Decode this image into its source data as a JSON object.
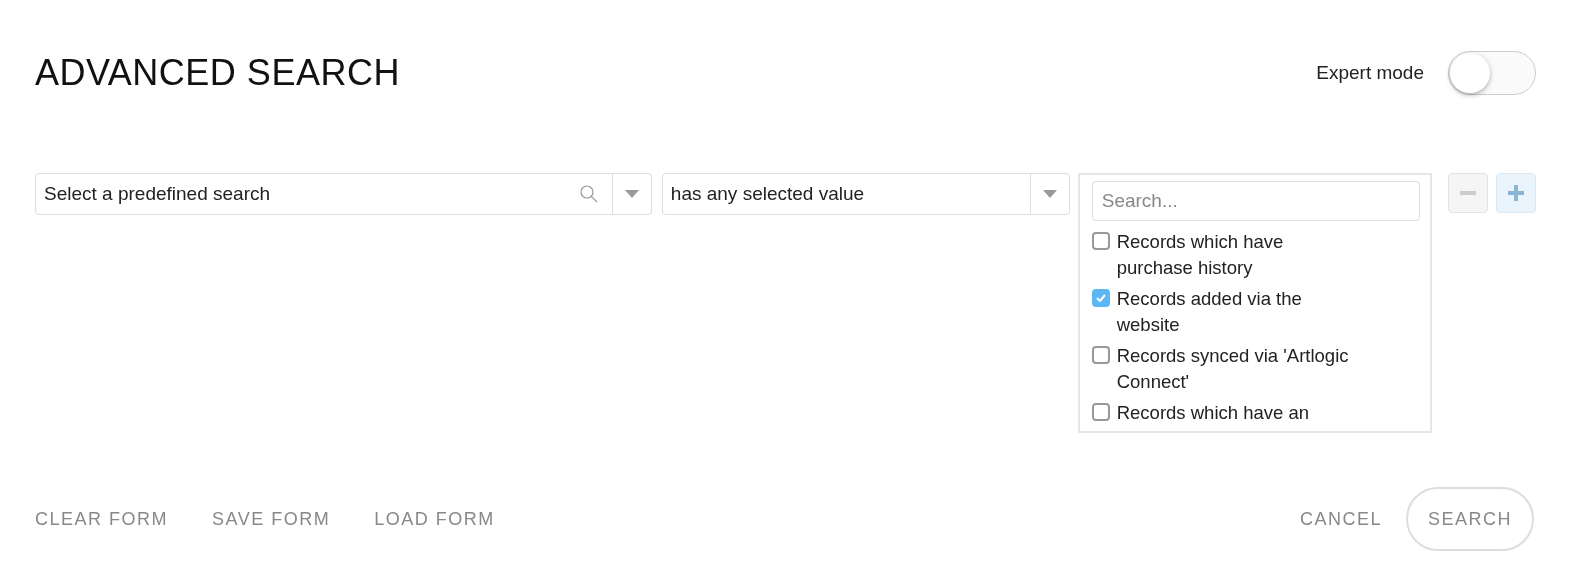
{
  "title": "ADVANCED SEARCH",
  "expert_mode": {
    "label": "Expert mode",
    "on": false
  },
  "criteria": {
    "predefined": {
      "placeholder": "Select a predefined search"
    },
    "operator": {
      "value": "has any selected value"
    },
    "values": {
      "search": {
        "placeholder": "Search..."
      },
      "options": [
        {
          "label": "Records which have purchase history",
          "checked": false
        },
        {
          "label": "Records added via the website",
          "checked": true
        },
        {
          "label": "Records synced via 'Artlogic Connect'",
          "checked": false
        },
        {
          "label": "Records which have an",
          "checked": false
        }
      ]
    }
  },
  "row_buttons": [
    {
      "kind": "remove",
      "disabled": true
    },
    {
      "kind": "add",
      "disabled": false
    }
  ],
  "footer": {
    "links": [
      "CLEAR FORM",
      "SAVE FORM",
      "LOAD FORM"
    ],
    "cancel": "CANCEL",
    "search": "SEARCH"
  }
}
